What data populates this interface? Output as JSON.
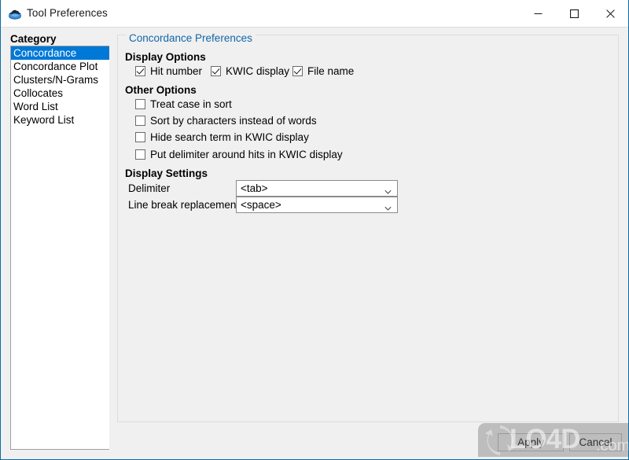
{
  "window": {
    "title": "Tool Preferences",
    "icon": "app-icon",
    "controls": {
      "minimize": "minimize-icon",
      "maximize": "maximize-icon",
      "close": "close-icon"
    },
    "border_color": "#0a6ca8"
  },
  "sidebar": {
    "heading": "Category",
    "selected_index": 0,
    "selection_color": "#0078d7",
    "items": [
      {
        "label": "Concordance"
      },
      {
        "label": "Concordance Plot"
      },
      {
        "label": "Clusters/N-Grams"
      },
      {
        "label": "Collocates"
      },
      {
        "label": "Word List"
      },
      {
        "label": "Keyword List"
      }
    ]
  },
  "main": {
    "legend": "Concordance Preferences",
    "legend_color": "#1266a8",
    "display_options": {
      "heading": "Display Options",
      "items": [
        {
          "label": "Hit number",
          "checked": true
        },
        {
          "label": "KWIC display",
          "checked": true
        },
        {
          "label": "File name",
          "checked": true
        }
      ]
    },
    "other_options": {
      "heading": "Other Options",
      "items": [
        {
          "label": "Treat case in sort",
          "checked": false
        },
        {
          "label": "Sort by characters instead of words",
          "checked": false
        },
        {
          "label": "Hide search term in KWIC display",
          "checked": false
        },
        {
          "label": "Put delimiter around hits in KWIC display",
          "checked": false
        }
      ]
    },
    "display_settings": {
      "heading": "Display Settings",
      "fields": [
        {
          "label": "Delimiter",
          "value": "<tab>",
          "arrow": "chevron-down-icon"
        },
        {
          "label": "Line break replacement",
          "value": "<space>",
          "arrow": "chevron-down-icon"
        }
      ]
    }
  },
  "footer": {
    "apply_label": "Apply",
    "cancel_label": "Cancel"
  },
  "watermark": {
    "text": "LO4D",
    "suffix": ".com",
    "logo": "refresh-arrows-icon"
  }
}
